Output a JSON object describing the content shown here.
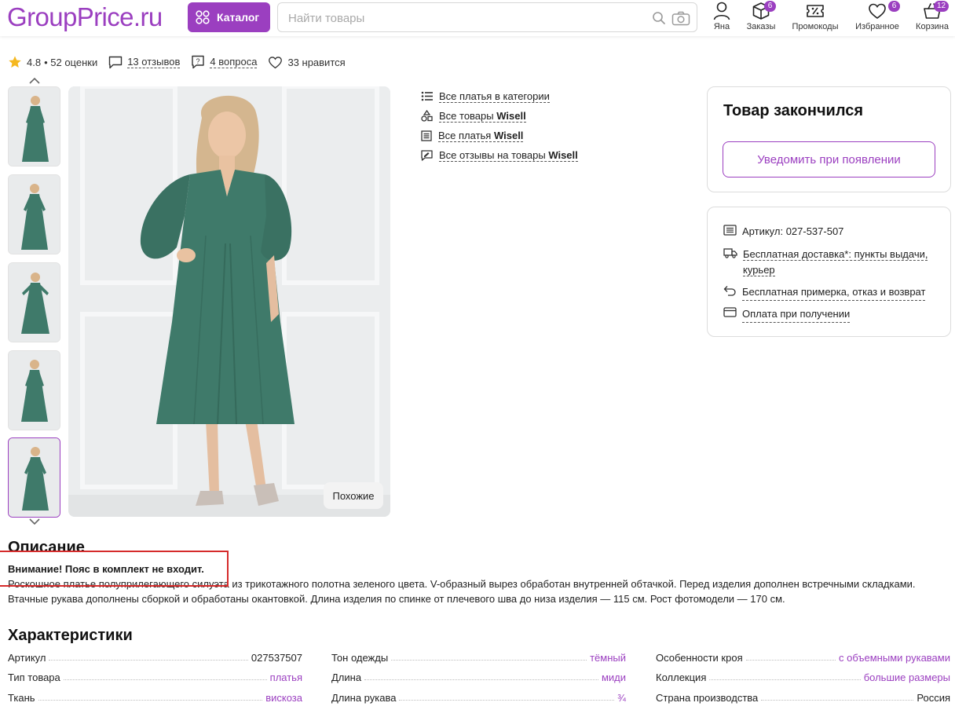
{
  "header": {
    "logo": "GroupPrice.ru",
    "catalog_label": "Каталог",
    "search_placeholder": "Найти товары",
    "items": [
      {
        "label": "Яна",
        "icon": "user-icon",
        "badge": ""
      },
      {
        "label": "Заказы",
        "icon": "box-icon",
        "badge": "6"
      },
      {
        "label": "Промокоды",
        "icon": "coupon-icon",
        "badge": ""
      },
      {
        "label": "Избранное",
        "icon": "heart-icon",
        "badge": "6"
      },
      {
        "label": "Корзина",
        "icon": "basket-icon",
        "badge": "12"
      }
    ]
  },
  "product": {
    "rating": "4.8",
    "ratings_count": "• 52 оценки",
    "reviews": "13 отзывов",
    "questions": "4 вопроса",
    "likes": "33 нравится",
    "similar_label": "Похожие"
  },
  "links": [
    {
      "text": "Все платья в категории",
      "bold": ""
    },
    {
      "text": "Все товары ",
      "bold": "Wisell"
    },
    {
      "text": "Все платья ",
      "bold": "Wisell"
    },
    {
      "text": "Все отзывы на товары ",
      "bold": "Wisell"
    }
  ],
  "stock": {
    "title": "Товар закончился",
    "notify_label": "Уведомить при появлении"
  },
  "info": {
    "article": "Артикул: 027-537-507",
    "delivery": "Бесплатная доставка*: пункты выдачи, курьер",
    "fitting": "Бесплатная примерка, отказ и возврат",
    "payment": "Оплата при получении"
  },
  "description": {
    "heading": "Описание",
    "warning": "Внимание! Пояс в комплект не входит.",
    "text": "Роскошное платье полуприлегающего силуэта из трикотажного полотна зеленого цвета. V-образный вырез обработан внутренней обтачкой. Перед изделия дополнен встречными складками. Втачные рукава дополнены сборкой и обработаны окантовкой. Длина изделия по спинке от плечевого шва до низа изделия — 115 см. Рост фотомодели — 170 см."
  },
  "specs": {
    "heading": "Характеристики",
    "rows": [
      {
        "key": "Артикул",
        "value": "027537507",
        "link": false
      },
      {
        "key": "Тон одежды",
        "value": "тёмный",
        "link": true
      },
      {
        "key": "Особенности кроя",
        "value": "с объемными рукавами",
        "link": true
      },
      {
        "key": "Тип товара",
        "value": "платья",
        "link": true
      },
      {
        "key": "Длина",
        "value": "миди",
        "link": true
      },
      {
        "key": "Коллекция",
        "value": "большие размеры",
        "link": true
      },
      {
        "key": "Ткань",
        "value": "вискоза",
        "link": true
      },
      {
        "key": "Длина рукава",
        "value": "¾",
        "link": true
      },
      {
        "key": "Страна производства",
        "value": "Россия",
        "link": false
      }
    ]
  },
  "colors": {
    "brand": "#9b3fc0",
    "dress": "#3f7a6a",
    "highlight": "#d52b2b"
  }
}
